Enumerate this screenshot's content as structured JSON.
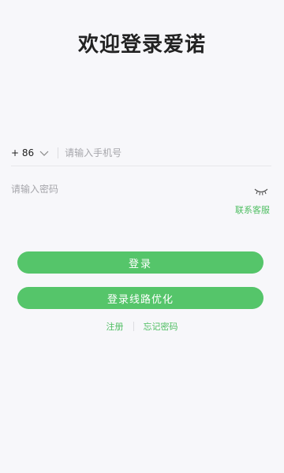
{
  "header": {
    "title": "欢迎登录爱诺"
  },
  "phone": {
    "country_code": "+ 86",
    "placeholder": "请输入手机号"
  },
  "password": {
    "placeholder": "请输入密码"
  },
  "support": {
    "label": "联系客服"
  },
  "buttons": {
    "login": "登录",
    "route_optimize": "登录线路优化"
  },
  "links": {
    "register": "注册",
    "forgot_password": "忘记密码"
  },
  "colors": {
    "accent": "#55c56a",
    "link": "#4fbe62",
    "background": "#f7f7fa"
  },
  "icons": {
    "country_dropdown": "chevron-down-icon",
    "password_visibility": "eye-closed-icon"
  }
}
